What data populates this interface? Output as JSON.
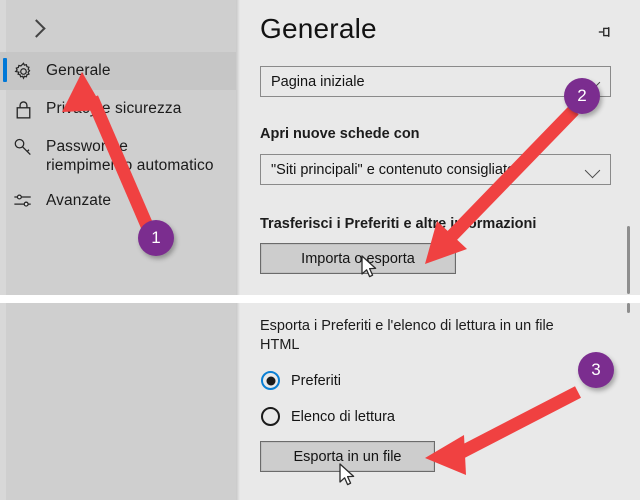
{
  "window": {
    "background_color": "#e9e9e9",
    "sidebar_color": "#cfcfcf",
    "accent_color": "#0078d7",
    "annotation_purple": "#7b2d8f",
    "annotation_red": "#f04141"
  },
  "sidebar": {
    "collapse_icon": "chevron-right-icon",
    "items": [
      {
        "label": "Generale",
        "icon": "gear-icon",
        "selected": true
      },
      {
        "label": "Privacy e sicurezza",
        "icon": "lock-icon",
        "selected": false
      },
      {
        "label": "Password e riempimento automatico",
        "icon": "key-icon",
        "selected": false
      },
      {
        "label": "Avanzate",
        "icon": "sliders-icon",
        "selected": false
      }
    ]
  },
  "content": {
    "title": "Generale",
    "pin_icon": "pin-icon",
    "homepage_combo": {
      "value": "Pagina iniziale",
      "chevron_icon": "chevron-down-icon"
    },
    "new_tabs": {
      "label": "Apri nuove schede con",
      "combo_value": "\"Siti principali\" e contenuto consigliato",
      "chevron_icon": "chevron-down-icon"
    },
    "transfer": {
      "label": "Trasferisci i Preferiti e altre informazioni",
      "button_label": "Importa o esporta"
    },
    "export": {
      "label": "Esporta i Preferiti e l'elenco di lettura in un file HTML",
      "options": [
        {
          "label": "Preferiti",
          "selected": true
        },
        {
          "label": "Elenco di lettura",
          "selected": false
        }
      ],
      "button_label": "Esporta in un file"
    }
  },
  "annotations": {
    "steps": [
      {
        "number": "1",
        "points_to": "sidebar-item-generale"
      },
      {
        "number": "2",
        "points_to": "importa-o-esporta-button"
      },
      {
        "number": "3",
        "points_to": "esporta-in-un-file-button"
      }
    ]
  }
}
